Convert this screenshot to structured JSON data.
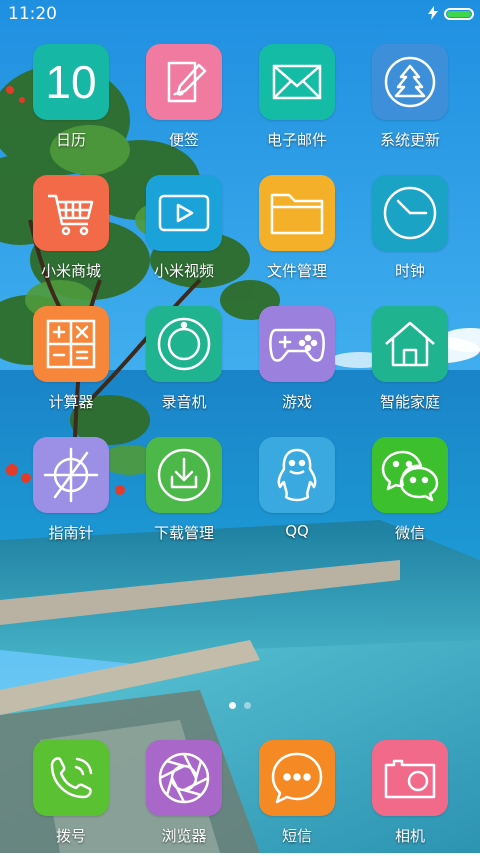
{
  "status_bar": {
    "time": "11:20",
    "battery_level": 1.0,
    "charging_icon": "lightning-icon"
  },
  "colors": {
    "calendar": "#16b7a5",
    "notes": "#f07aa0",
    "email": "#14bca6",
    "update": "#3d8fd9",
    "shop": "#f26a48",
    "video": "#1ba3d9",
    "files": "#f5b02a",
    "clock": "#1ba3c6",
    "calculator": "#f5863a",
    "recorder": "#1fb38f",
    "games": "#9c80de",
    "smarthome": "#1fb38f",
    "compass": "#9b8fe6",
    "download": "#4cb84a",
    "qq": "#3aa9e0",
    "wechat": "#3dc02e",
    "phone": "#5ac132",
    "browser": "#a968c9",
    "sms": "#f58a25",
    "camera": "#f26a8a"
  },
  "apps": [
    {
      "label": "日历",
      "icon": "calendar-icon",
      "day": "10"
    },
    {
      "label": "便签",
      "icon": "notes-icon"
    },
    {
      "label": "电子邮件",
      "icon": "mail-icon"
    },
    {
      "label": "系统更新",
      "icon": "update-icon"
    },
    {
      "label": "小米商城",
      "icon": "shopping-cart-icon"
    },
    {
      "label": "小米视频",
      "icon": "video-play-icon"
    },
    {
      "label": "文件管理",
      "icon": "folder-icon"
    },
    {
      "label": "时钟",
      "icon": "clock-icon"
    },
    {
      "label": "计算器",
      "icon": "calculator-icon"
    },
    {
      "label": "录音机",
      "icon": "recorder-icon"
    },
    {
      "label": "游戏",
      "icon": "gamepad-icon"
    },
    {
      "label": "智能家庭",
      "icon": "home-icon"
    },
    {
      "label": "指南针",
      "icon": "compass-icon"
    },
    {
      "label": "下载管理",
      "icon": "download-icon"
    },
    {
      "label": "QQ",
      "icon": "qq-penguin-icon"
    },
    {
      "label": "微信",
      "icon": "wechat-icon"
    }
  ],
  "dock": [
    {
      "label": "拨号",
      "icon": "phone-icon"
    },
    {
      "label": "浏览器",
      "icon": "browser-icon"
    },
    {
      "label": "短信",
      "icon": "message-icon"
    },
    {
      "label": "相机",
      "icon": "camera-icon"
    }
  ],
  "pages": {
    "count": 2,
    "current": 1
  }
}
